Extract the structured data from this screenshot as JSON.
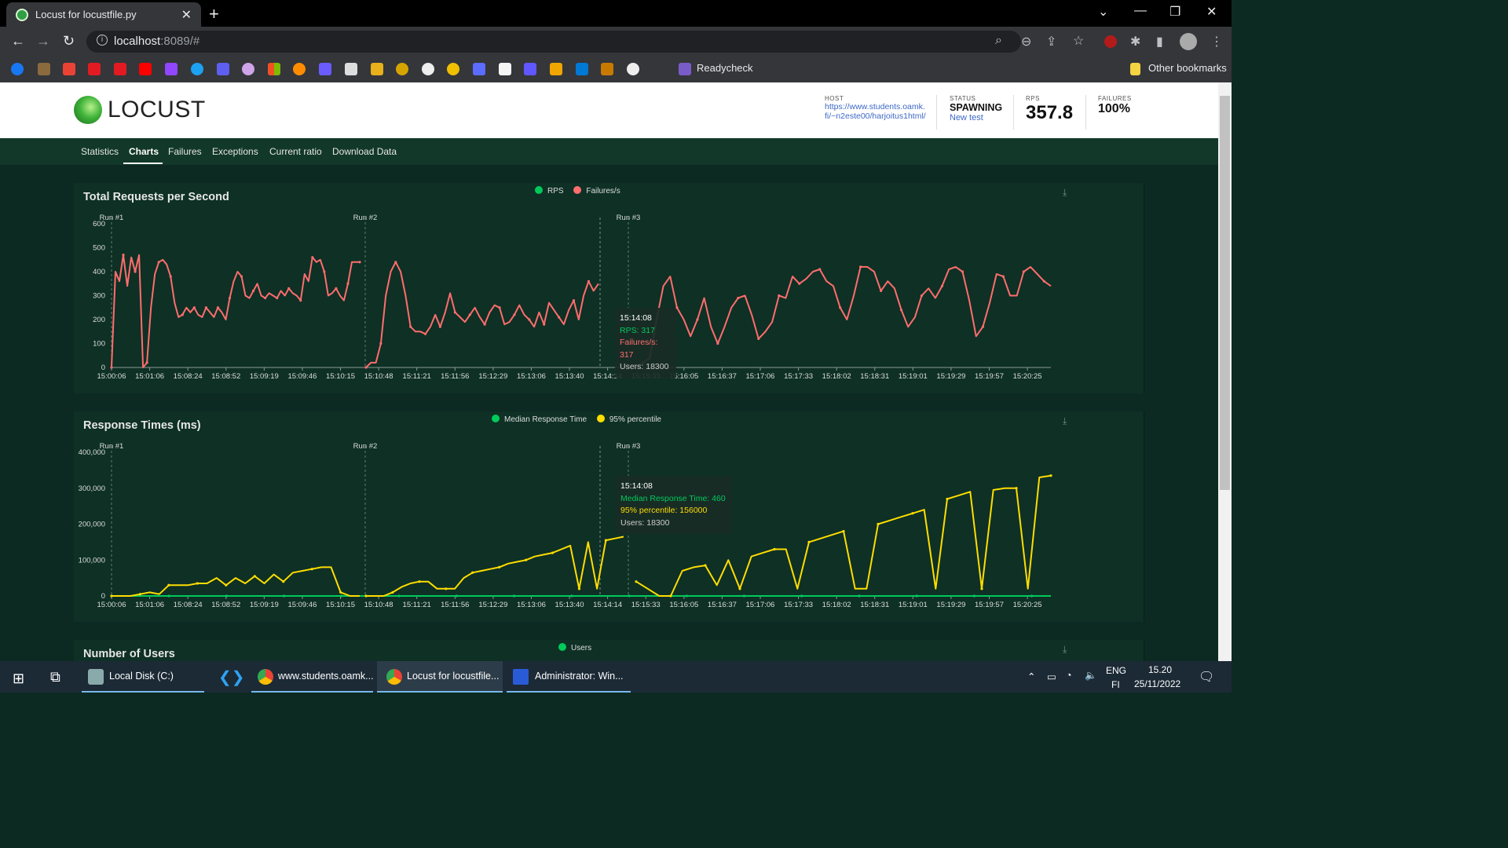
{
  "browser": {
    "tab_title": "Locust for locustfile.py",
    "tab_close": "✕",
    "new_tab": "+",
    "url_host": "localhost",
    "url_rest": ":8089/#",
    "bookmarks_label_readycheck": "Readycheck",
    "bookmarks_other": "Other bookmarks",
    "win_min": "—",
    "win_restore": "❐",
    "win_close": "✕"
  },
  "header": {
    "logo_text": "LOCUST",
    "host_label": "HOST",
    "host_value": "https://www.students.oamk.fi/~n2este00/harjoitus1html/",
    "status_label": "STATUS",
    "status_value": "SPAWNING",
    "new_test": "New test",
    "rps_label": "RPS",
    "rps_value": "357.8",
    "failures_label": "FAILURES",
    "failures_value": "100%"
  },
  "nav": {
    "tabs": [
      "Statistics",
      "Charts",
      "Failures",
      "Exceptions",
      "Current ratio",
      "Download Data"
    ],
    "active": "Charts"
  },
  "chart_data": [
    {
      "type": "line",
      "title": "Total Requests per Second",
      "series": [
        {
          "name": "RPS",
          "color": "#00ca5a"
        },
        {
          "name": "Failures/s",
          "color": "#ff6d6d",
          "values": [
            0,
            400,
            360,
            470,
            340,
            460,
            400,
            470,
            0,
            20,
            250,
            390,
            440,
            450,
            430,
            380,
            270,
            210,
            220,
            250,
            230,
            250,
            220,
            210,
            250,
            230,
            210,
            250,
            230,
            200,
            290,
            360,
            400,
            380,
            300,
            290,
            320,
            350,
            300,
            290,
            310,
            300,
            290,
            320,
            300,
            330,
            310,
            300,
            280,
            390,
            360,
            460,
            440,
            450,
            400,
            300,
            310,
            330,
            300,
            280,
            350,
            440,
            440,
            440
          ]
        },
        {
          "name": "Failures/s (run 2)",
          "values": [
            0,
            20,
            20,
            100,
            300,
            400,
            440,
            400,
            300,
            170,
            150,
            150,
            140,
            170,
            220,
            170,
            230,
            310,
            230,
            210,
            190,
            220,
            250,
            210,
            180,
            230,
            260,
            250,
            180,
            190,
            220,
            260,
            220,
            200,
            170,
            230,
            180,
            270,
            240,
            210,
            180,
            240,
            280,
            200,
            300,
            360,
            320,
            350
          ]
        },
        {
          "name": "Failures/s (run 3)",
          "values": [
            0,
            20,
            40,
            200,
            340,
            380,
            250,
            200,
            130,
            200,
            290,
            170,
            100,
            170,
            250,
            290,
            300,
            220,
            120,
            150,
            190,
            300,
            290,
            380,
            350,
            370,
            400,
            410,
            360,
            340,
            250,
            200,
            300,
            420,
            420,
            400,
            320,
            360,
            330,
            240,
            170,
            210,
            300,
            330,
            290,
            340,
            410,
            420,
            400,
            280,
            130,
            170,
            270,
            390,
            380,
            300,
            300,
            400,
            420,
            390,
            360,
            340
          ]
        }
      ],
      "x_ticks": [
        "15:00:06",
        "15:01:06",
        "15:08:24",
        "15:08:52",
        "15:09:19",
        "15:09:46",
        "15:10:15",
        "15:10:48",
        "15:11:21",
        "15:11:56",
        "15:12:29",
        "15:13:06",
        "15:13:40",
        "15:14:14",
        "15:15:33",
        "15:16:05",
        "15:16:37",
        "15:17:06",
        "15:17:33",
        "15:18:02",
        "15:18:31",
        "15:19:01",
        "15:19:29",
        "15:19:57",
        "15:20:25"
      ],
      "y_ticks": [
        "0",
        "100",
        "200",
        "300",
        "400",
        "500",
        "600"
      ],
      "ylim": [
        0,
        600
      ],
      "markers": [
        "Run #1",
        "Run #2",
        "Run #3"
      ],
      "tooltip": {
        "time": "15:14:08",
        "rps": "RPS: 317",
        "fail": "Failures/s: 317",
        "users": "Users: 18300"
      }
    },
    {
      "type": "line",
      "title": "Response Times (ms)",
      "series": [
        {
          "name": "Median Response Time",
          "color": "#00ca5a",
          "values": [
            0,
            0,
            0,
            0,
            0,
            0,
            0,
            0,
            0,
            0,
            0,
            0,
            0,
            0,
            0,
            0,
            0,
            0,
            0,
            0,
            0,
            0,
            0,
            0,
            0,
            0,
            0,
            0,
            0,
            0,
            0,
            0,
            0,
            0,
            0,
            0,
            0,
            0,
            0,
            0,
            0,
            0,
            0,
            0,
            0,
            0,
            0,
            0,
            0,
            0
          ]
        },
        {
          "name": "95% percentile",
          "color": "#ffdd00",
          "values": [
            0,
            0,
            0,
            5000,
            10000,
            5000,
            30000,
            30000,
            30000,
            35000,
            35000,
            50000,
            30000,
            50000,
            35000,
            55000,
            35000,
            60000,
            40000,
            65000,
            70000,
            75000,
            80000,
            80000,
            10000,
            0,
            0
          ]
        },
        {
          "name": "95% percentile (run 2)",
          "values": [
            0,
            0,
            0,
            10000,
            25000,
            35000,
            40000,
            40000,
            20000,
            20000,
            20000,
            50000,
            65000,
            70000,
            75000,
            80000,
            90000,
            95000,
            100000,
            110000,
            115000,
            120000,
            130000,
            140000,
            20000,
            150000,
            20000,
            155000,
            160000,
            165000
          ]
        },
        {
          "name": "95% percentile (run 3)",
          "values": [
            40000,
            20000,
            0,
            0,
            70000,
            80000,
            85000,
            30000,
            100000,
            20000,
            110000,
            120000,
            130000,
            130000,
            20000,
            150000,
            160000,
            170000,
            180000,
            20000,
            20000,
            200000,
            210000,
            220000,
            230000,
            240000,
            20000,
            270000,
            280000,
            290000,
            20000,
            295000,
            300000,
            300000,
            20000,
            330000,
            335000
          ]
        }
      ],
      "x_ticks": [
        "15:00:06",
        "15:01:06",
        "15:08:24",
        "15:08:52",
        "15:09:19",
        "15:09:46",
        "15:10:15",
        "15:10:48",
        "15:11:21",
        "15:11:56",
        "15:12:29",
        "15:13:06",
        "15:13:40",
        "15:14:14",
        "15:15:33",
        "15:16:05",
        "15:16:37",
        "15:17:06",
        "15:17:33",
        "15:18:02",
        "15:18:31",
        "15:19:01",
        "15:19:29",
        "15:19:57",
        "15:20:25"
      ],
      "y_ticks": [
        "0",
        "100,000",
        "200,000",
        "300,000",
        "400,000"
      ],
      "ylim": [
        0,
        400000
      ],
      "markers": [
        "Run #1",
        "Run #2",
        "Run #3"
      ],
      "tooltip": {
        "time": "15:14:08",
        "median": "Median Response Time: 460",
        "p95": "95% percentile: 156000",
        "users": "Users: 18300"
      }
    },
    {
      "type": "line",
      "title": "Number of Users",
      "series": [
        {
          "name": "Users",
          "color": "#00ca5a"
        }
      ]
    }
  ],
  "taskbar": {
    "items": [
      "Local Disk (C:)",
      "www.students.oamk...",
      "Locust for locustfile...",
      "Administrator: Win..."
    ],
    "lang": "ENG",
    "region": "FI",
    "time": "15.20",
    "date": "25/11/2022"
  }
}
